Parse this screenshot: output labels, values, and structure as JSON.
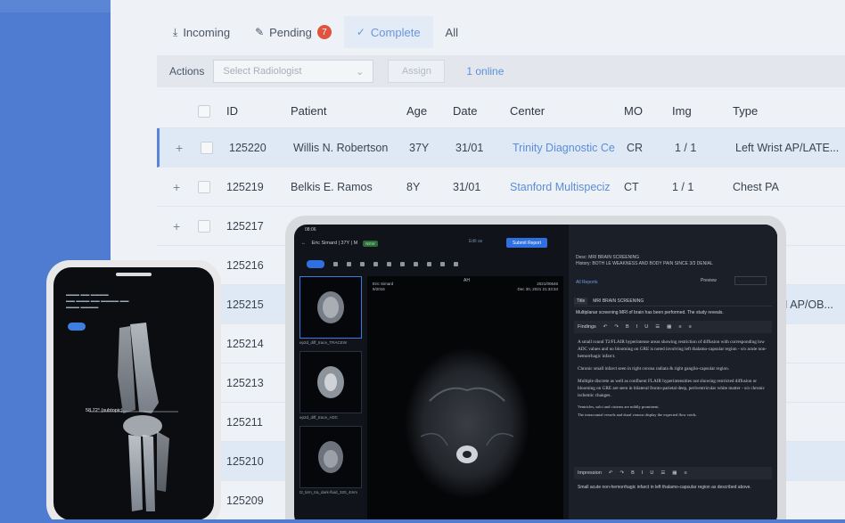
{
  "tabs": [
    {
      "icon": "download-icon",
      "label": "Incoming"
    },
    {
      "icon": "pencil-icon",
      "label": "Pending",
      "badge": "7"
    },
    {
      "icon": "check-icon",
      "label": "Complete"
    },
    {
      "icon": "",
      "label": "All"
    }
  ],
  "actions": {
    "label": "Actions",
    "select_placeholder": "Select Radiologist",
    "assign_label": "Assign",
    "online_text": "1 online"
  },
  "table": {
    "headers": [
      "ID",
      "Patient",
      "Age",
      "Date",
      "Center",
      "MO",
      "Img",
      "Type"
    ],
    "rows": [
      {
        "id": "125220",
        "patient": "Willis N. Robertson",
        "age": "37Y",
        "date": "31/01",
        "center": "Trinity Diagnostic Ce",
        "mo": "CR",
        "img": "1 / 1",
        "type": "Left Wrist AP/LATE..."
      },
      {
        "id": "125219",
        "patient": "Belkis E. Ramos",
        "age": "8Y",
        "date": "31/01",
        "center": "Stanford Multispeciz",
        "mo": "CT",
        "img": "1 / 1",
        "type": "Chest PA"
      },
      {
        "id": "125217",
        "patient": "",
        "age": "",
        "date": "",
        "center": "",
        "mo": "",
        "img": "",
        "type": ""
      },
      {
        "id": "125216",
        "patient": "",
        "age": "",
        "date": "",
        "center": "",
        "mo": "",
        "img": "",
        "type": ""
      },
      {
        "id": "125215",
        "patient": "",
        "age": "",
        "date": "",
        "center": "",
        "mo": "",
        "img": "",
        "type": "I AP/OB..."
      },
      {
        "id": "125214",
        "patient": "",
        "age": "",
        "date": "",
        "center": "",
        "mo": "",
        "img": "",
        "type": ""
      },
      {
        "id": "125213",
        "patient": "",
        "age": "",
        "date": "",
        "center": "",
        "mo": "",
        "img": "",
        "type": ""
      },
      {
        "id": "125211",
        "patient": "",
        "age": "",
        "date": "",
        "center": "",
        "mo": "",
        "img": "",
        "type": ""
      },
      {
        "id": "125210",
        "patient": "",
        "age": "",
        "date": "",
        "center": "",
        "mo": "",
        "img": "",
        "type": ""
      },
      {
        "id": "125209",
        "patient": "",
        "age": "",
        "date": "",
        "center": "",
        "mo": "",
        "img": "",
        "type": ""
      }
    ]
  },
  "phone": {
    "meas": "58.72° (subtopic)"
  },
  "tablet": {
    "status_time": "08:06",
    "patient": "Eric Simard | 37Y | M",
    "patient_tag": "NEW",
    "draft": "Edit as",
    "submit": "Submit Report",
    "thumb1": "ep2d_diff_trace_TRACEW",
    "thumb2": "ep2d_diff_trace_ADC",
    "thumb3": "t2_tirm_tra_dark-fluid_320_4mm",
    "viewer_left": "Eric Simard\n9/2016",
    "viewer_right": "2021/00646\nDec 30, 2021 21:33:34",
    "viewer_axis": "AH",
    "desc": "Desc: MRI BRAIN SCREENING",
    "history": "History: BOTH LE WEAKNESS AND BODY PAIN SINCE 3/3 DENIAL",
    "all_reports": "All Reports",
    "preview": "Preview",
    "title_label": "Title",
    "title_value": "MRI BRAIN SCREENING",
    "summary": "Multiplanar screening MRI of brain has been performed. The study reveals.",
    "findings_label": "Findings",
    "findings_p1": "A small round T2/FLAIR hyperintense areas showing restriction of diffusion with corresponding low ADC values and no blooming on GRE is noted involving left thalamo-capsular region - s/o acute non-hemorrhagic infarct.",
    "findings_p2": "Chronic small infarct seen in right corona radiata & right ganglio-capsular region.",
    "findings_p3": "Multiple discrete as well as confluent FLAIR hyperintensities not showing restricted diffusion or blooming on GRE are seen in bilateral fronto-parietal deep, periventricular white matter - s/o chronic ischemic changes.",
    "findings_p4": "Ventricles, sulci and cisterns are mildly prominent.",
    "findings_p5": "The intracranial vessels and dural venous display the expected flow voids.",
    "impression_label": "Impression",
    "impression_text": "Small acute non-hemorrhagic infarct in left thalamo-capsular region as described above."
  }
}
